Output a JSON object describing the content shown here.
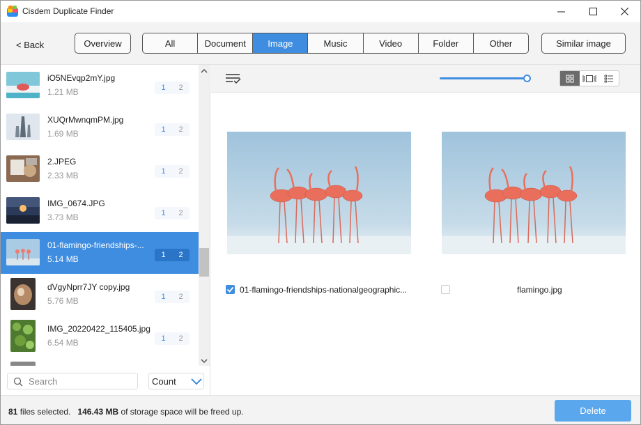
{
  "window": {
    "title": "Cisdem Duplicate Finder"
  },
  "toolbar": {
    "back_label": "< Back",
    "overview_label": "Overview",
    "similar_label": "Similar image",
    "tabs": [
      {
        "label": "All",
        "active": false
      },
      {
        "label": "Document",
        "active": false
      },
      {
        "label": "Image",
        "active": true
      },
      {
        "label": "Music",
        "active": false
      },
      {
        "label": "Video",
        "active": false
      },
      {
        "label": "Folder",
        "active": false
      },
      {
        "label": "Other",
        "active": false
      }
    ]
  },
  "file_list": {
    "items": [
      {
        "name": "iO5NEvqp2mY.jpg",
        "size": "1.21 MB",
        "count_a": "1",
        "count_b": "2",
        "selected": false
      },
      {
        "name": "XUQrMwnqmPM.jpg",
        "size": "1.69 MB",
        "count_a": "1",
        "count_b": "2",
        "selected": false
      },
      {
        "name": "2.JPEG",
        "size": "2.33 MB",
        "count_a": "1",
        "count_b": "2",
        "selected": false
      },
      {
        "name": "IMG_0674.JPG",
        "size": "3.73 MB",
        "count_a": "1",
        "count_b": "2",
        "selected": false
      },
      {
        "name": "01-flamingo-friendships-...",
        "size": "5.14 MB",
        "count_a": "1",
        "count_b": "2",
        "selected": true
      },
      {
        "name": "dVgyNprr7JY copy.jpg",
        "size": "5.76 MB",
        "count_a": "1",
        "count_b": "2",
        "selected": false
      },
      {
        "name": "IMG_20220422_115405.jpg",
        "size": "6.54 MB",
        "count_a": "1",
        "count_b": "2",
        "selected": false
      }
    ],
    "search_placeholder": "Search",
    "sort_label": "Count"
  },
  "preview": {
    "cards": [
      {
        "label": "01-flamingo-friendships-nationalgeographic...",
        "checked": true
      },
      {
        "label": "flamingo.jpg",
        "checked": false
      }
    ]
  },
  "status": {
    "files_count": "81",
    "files_text": "files selected.",
    "size": "146.43 MB",
    "size_text": "of storage space will be freed up.",
    "delete_label": "Delete"
  },
  "colors": {
    "accent": "#3f8de0",
    "delete_button": "#5aa7ee"
  }
}
